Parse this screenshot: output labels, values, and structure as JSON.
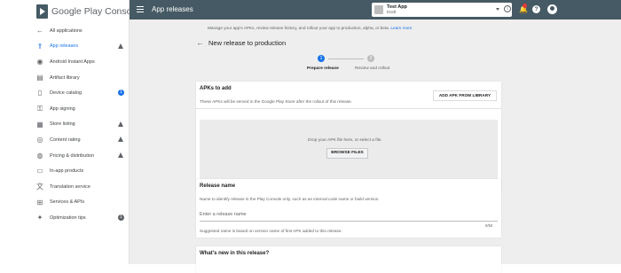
{
  "brand": {
    "name": "Google Play Console"
  },
  "nav": {
    "items": [
      {
        "label": "All applications",
        "icon": "arrow-left-icon",
        "glyph": "←",
        "active": false,
        "indicator": ""
      },
      {
        "label": "App releases",
        "icon": "rocket-icon",
        "glyph": "⇑",
        "active": true,
        "indicator": "warning"
      },
      {
        "label": "Android Instant Apps",
        "icon": "instant-icon",
        "glyph": "◉",
        "active": false,
        "indicator": ""
      },
      {
        "label": "Artifact library",
        "icon": "library-icon",
        "glyph": "▤",
        "active": false,
        "indicator": ""
      },
      {
        "label": "Device catalog",
        "icon": "device-icon",
        "glyph": "▯",
        "active": false,
        "indicator": "blue-badge"
      },
      {
        "label": "App signing",
        "icon": "key-icon",
        "glyph": "⚿",
        "active": false,
        "indicator": ""
      },
      {
        "label": "Store listing",
        "icon": "store-icon",
        "glyph": "▦",
        "active": false,
        "indicator": "warning"
      },
      {
        "label": "Content rating",
        "icon": "rating-icon",
        "glyph": "◎",
        "active": false,
        "indicator": "warning"
      },
      {
        "label": "Pricing & distribution",
        "icon": "globe-icon",
        "glyph": "◍",
        "active": false,
        "indicator": "warning"
      },
      {
        "label": "In-app products",
        "icon": "card-icon",
        "glyph": "▭",
        "active": false,
        "indicator": ""
      },
      {
        "label": "Translation service",
        "icon": "translate-icon",
        "glyph": "文",
        "active": false,
        "indicator": ""
      },
      {
        "label": "Services & APIs",
        "icon": "services-icon",
        "glyph": "⊞",
        "active": false,
        "indicator": ""
      },
      {
        "label": "Optimization tips",
        "icon": "bulb-icon",
        "glyph": "✦",
        "active": false,
        "indicator": "grey-badge"
      }
    ],
    "badges": {
      "device_catalog": "1",
      "optimization_tips": "1"
    }
  },
  "topbar": {
    "title": "App releases",
    "app_name": "Test App",
    "app_status": "Draft",
    "info_glyph": "i",
    "notifications_count": "",
    "help_glyph": "?"
  },
  "main": {
    "description": "Manage your app's APKs, review release history, and rollout your app to production, alpha, or beta.",
    "learn_more": "Learn more",
    "page_title": "New release to production",
    "steps": [
      {
        "number": "1",
        "label": "Prepare release"
      },
      {
        "number": "2",
        "label": "Review and rollout"
      }
    ],
    "apks": {
      "title": "APKs to add",
      "description": "These APKs will be served in the Google Play Store after the rollout of this release.",
      "add_button": "ADD APK FROM LIBRARY",
      "drop_text": "Drop your APK file here, or select a file.",
      "browse_button": "BROWSE FILES"
    },
    "release_name": {
      "title": "Release name",
      "description": "Name to identify release in the Play Console only, such as an internal code name or build version.",
      "placeholder": "Enter a release name",
      "counter": "0/50",
      "hint": "Suggested name is based on version name of first APK added to this release."
    },
    "whats_new": {
      "title": "What's new in this release?"
    }
  },
  "colors": {
    "accent": "#1a73e8",
    "topbar": "#455a64",
    "background": "#eeeeee"
  }
}
